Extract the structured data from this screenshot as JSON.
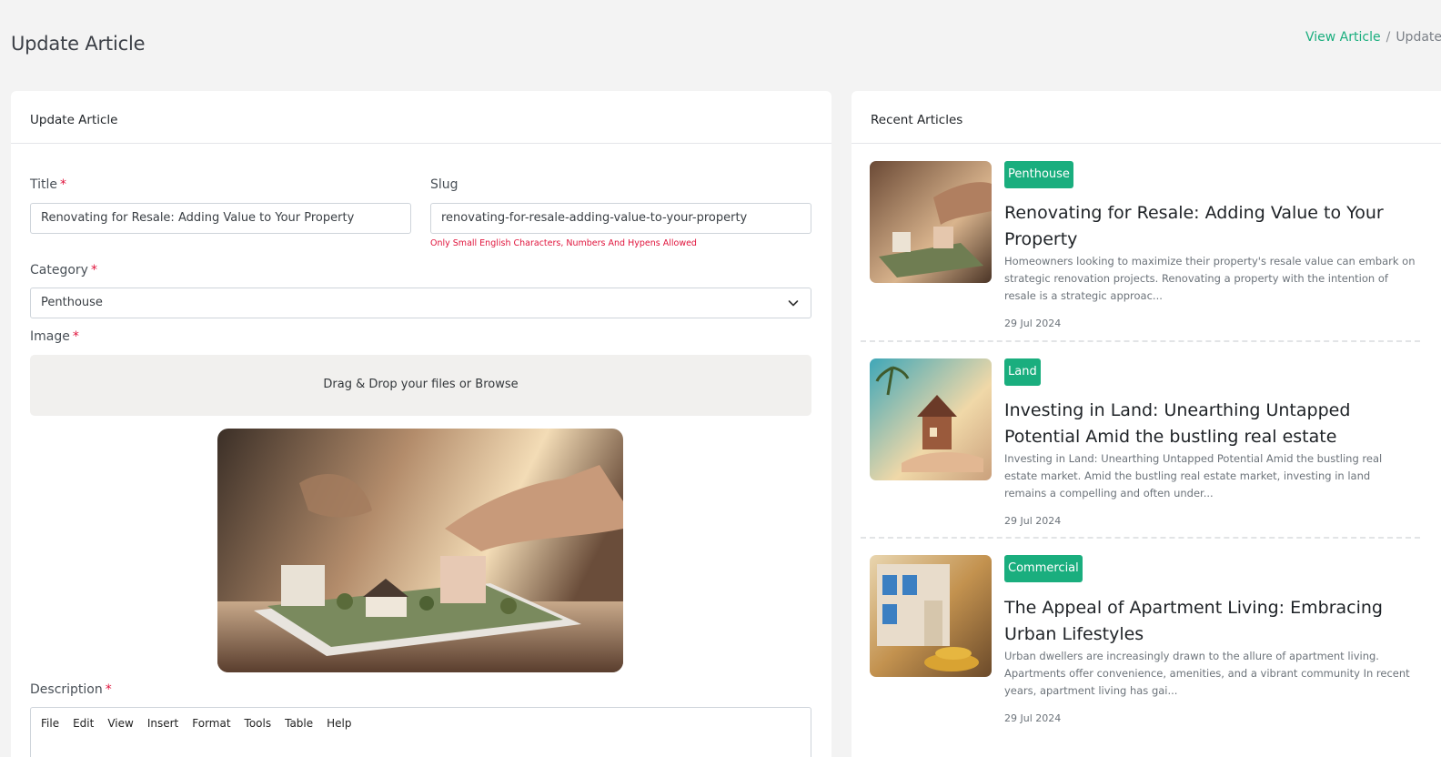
{
  "page": {
    "title": "Update Article"
  },
  "breadcrumb": {
    "parent": "View Article",
    "separator": "/",
    "current": "Update Article"
  },
  "form_card": {
    "header": "Update Article",
    "title_label": "Title",
    "title_value": "Renovating for Resale: Adding Value to Your Property",
    "slug_label": "Slug",
    "slug_value": "renovating-for-resale-adding-value-to-your-property",
    "slug_hint": "Only Small English Characters, Numbers And Hypens Allowed",
    "category_label": "Category",
    "category_value": "Penthouse",
    "image_label": "Image",
    "dropzone_text": "Drag & Drop your files or Browse",
    "description_label": "Description",
    "required_mark": "*",
    "editor_menu": [
      "File",
      "Edit",
      "View",
      "Insert",
      "Format",
      "Tools",
      "Table",
      "Help"
    ]
  },
  "recent_card": {
    "header": "Recent Articles",
    "articles": [
      {
        "category": "Penthouse",
        "title": "Renovating for Resale: Adding Value to Your Property",
        "excerpt": "Homeowners looking to maximize their property's resale value can embark on strategic renovation projects. Renovating a property with the intention of resale is a strategic approac...",
        "date": "29 Jul 2024"
      },
      {
        "category": "Land",
        "title": "Investing in Land: Unearthing Untapped Potential Amid the bustling real estate market...",
        "excerpt": "Investing in Land: Unearthing Untapped Potential Amid the bustling real estate market. Amid the bustling real estate market, investing in land remains a compelling and often under...",
        "date": "29 Jul 2024"
      },
      {
        "category": "Commercial",
        "title": "The Appeal of Apartment Living: Embracing Urban Lifestyles",
        "excerpt": "Urban dwellers are increasingly drawn to the allure of apartment living. Apartments offer convenience, amenities, and a vibrant community In recent years, apartment living has gai...",
        "date": "29 Jul 2024"
      }
    ]
  },
  "colors": {
    "accent": "#1aae7e",
    "required": "#e0143c",
    "background": "#f3f3f3"
  }
}
